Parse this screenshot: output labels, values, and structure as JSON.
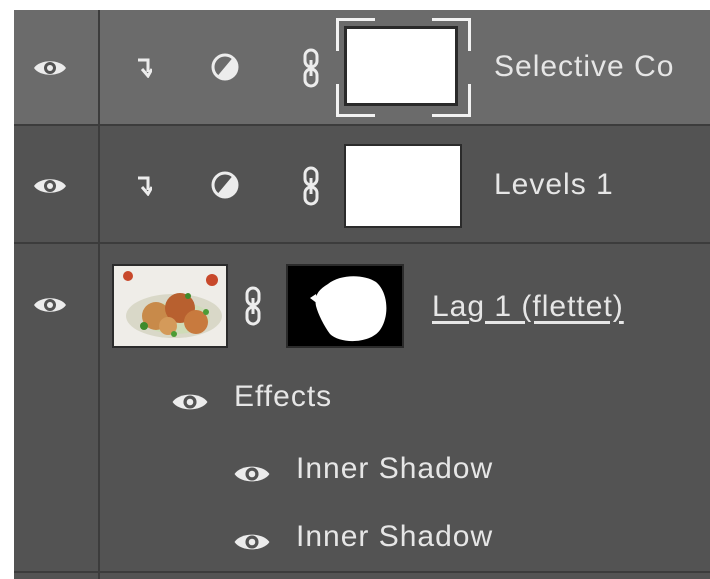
{
  "layers": {
    "selective_color": {
      "label": "Selective Co",
      "visibility_icon": "eye-icon",
      "clip_icon": "clip-arrow-icon",
      "adjustment_icon": "adjustment-circle-icon",
      "link_icon": "chain-link-icon"
    },
    "levels": {
      "label": "Levels 1",
      "visibility_icon": "eye-icon",
      "clip_icon": "clip-arrow-icon",
      "adjustment_icon": "adjustment-circle-icon",
      "link_icon": "chain-link-icon"
    },
    "photo_layer": {
      "label": "Lag 1 (flettet)",
      "visibility_icon": "eye-icon",
      "link_icon": "chain-link-icon",
      "effects": {
        "label": "Effects",
        "items": [
          {
            "label": "Inner Shadow"
          },
          {
            "label": "Inner Shadow"
          }
        ]
      }
    }
  },
  "colors": {
    "panel_bg": "#535353",
    "selected_row_bg": "#6b6b6b",
    "divider": "#3c3c3c",
    "text": "#e6e6e6"
  }
}
